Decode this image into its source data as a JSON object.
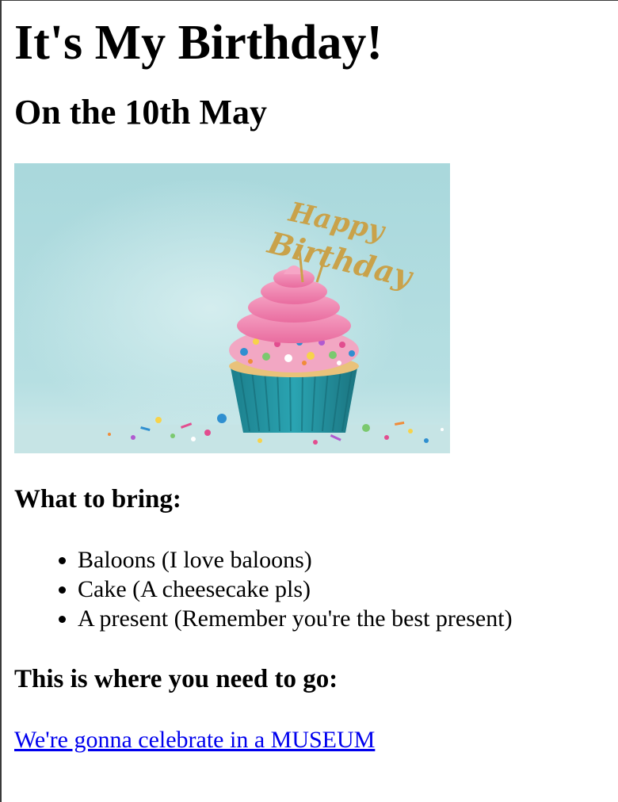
{
  "page": {
    "title": "It's My Birthday!",
    "subtitle": "On the 10th May",
    "image": {
      "icon": "birthday-cupcake-image",
      "topper_text": "Happy Birthday",
      "colors": {
        "background": "#a8d7db",
        "frosting": "#f07fae",
        "wrapper": "#249aa8",
        "topper": "#c9a24a"
      }
    },
    "bring_heading": "What to bring:",
    "bring_items": [
      "Baloons (I love baloons)",
      "Cake (A cheesecake pls)",
      "A present (Remember you're the best present)"
    ],
    "go_heading": "This is where you need to go:",
    "link_text": "We're gonna celebrate in a MUSEUM",
    "link_color": "#0000ee"
  }
}
